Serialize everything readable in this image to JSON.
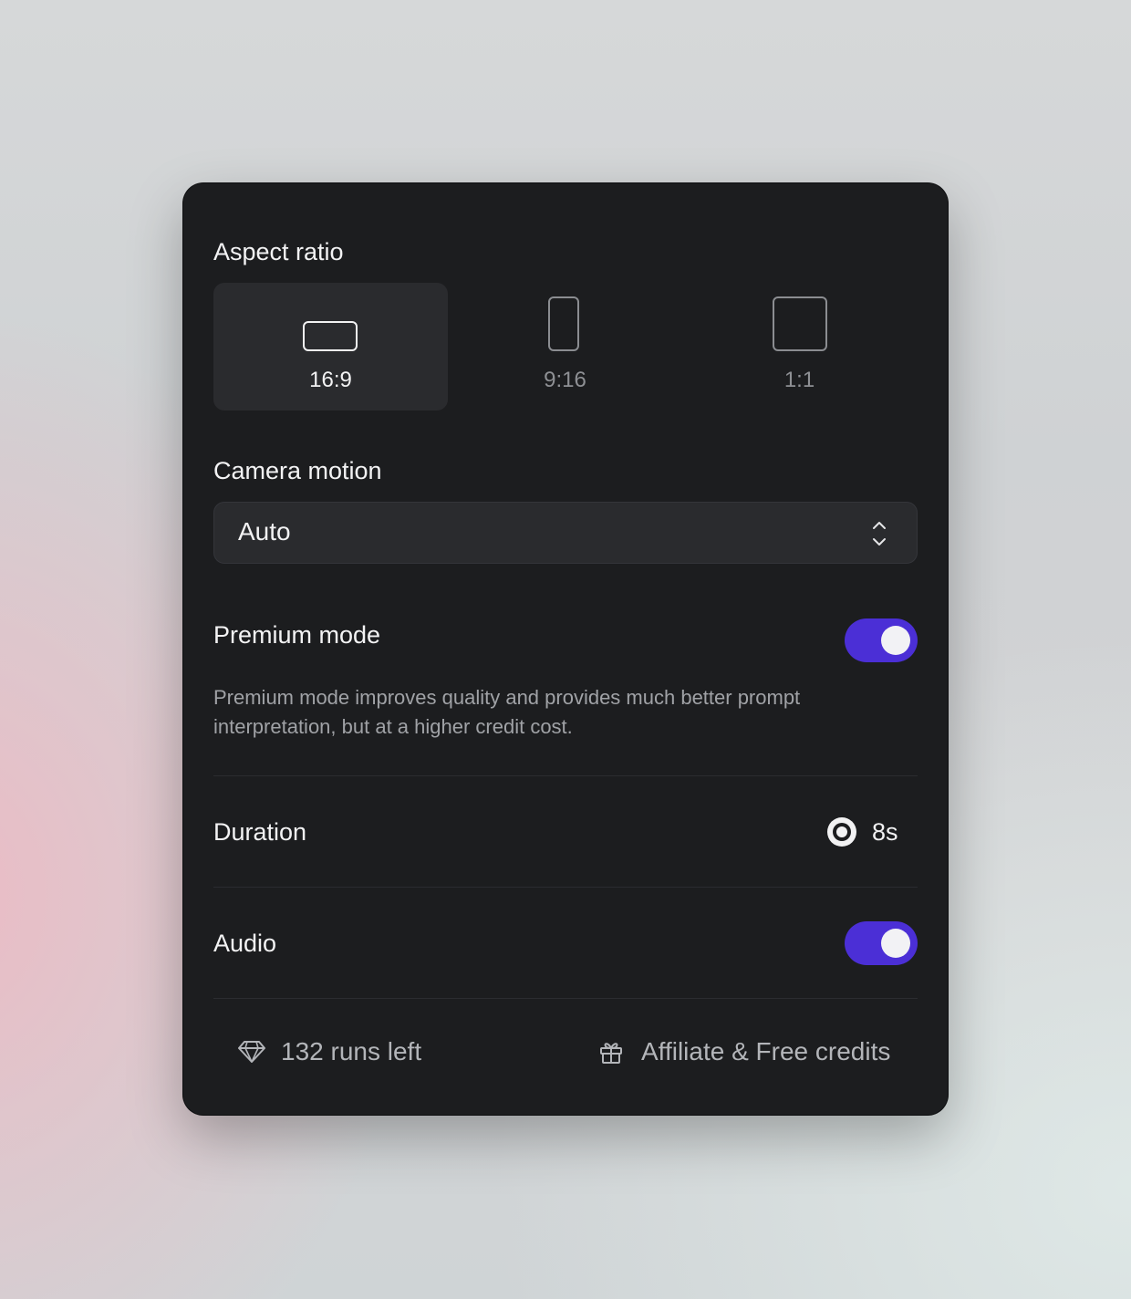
{
  "aspect_ratio": {
    "title": "Aspect ratio",
    "options": [
      {
        "label": "16:9",
        "selected": true
      },
      {
        "label": "9:16",
        "selected": false
      },
      {
        "label": "1:1",
        "selected": false
      }
    ]
  },
  "camera_motion": {
    "title": "Camera motion",
    "value": "Auto"
  },
  "premium_mode": {
    "title": "Premium mode",
    "enabled": true,
    "description": "Premium mode improves quality and provides much better prompt interpretation, but at a higher credit cost."
  },
  "duration": {
    "title": "Duration",
    "value": "8s",
    "selected": true
  },
  "audio": {
    "title": "Audio",
    "enabled": true
  },
  "footer": {
    "runs_left": "132 runs left",
    "runs_icon": "diamond-icon",
    "affiliate_label": "Affiliate & Free credits",
    "affiliate_icon": "gift-icon"
  },
  "colors": {
    "panel_background": "#1c1d1f",
    "toggle_accent": "#4b2fd6",
    "selected_tile": "#2a2b2e"
  }
}
